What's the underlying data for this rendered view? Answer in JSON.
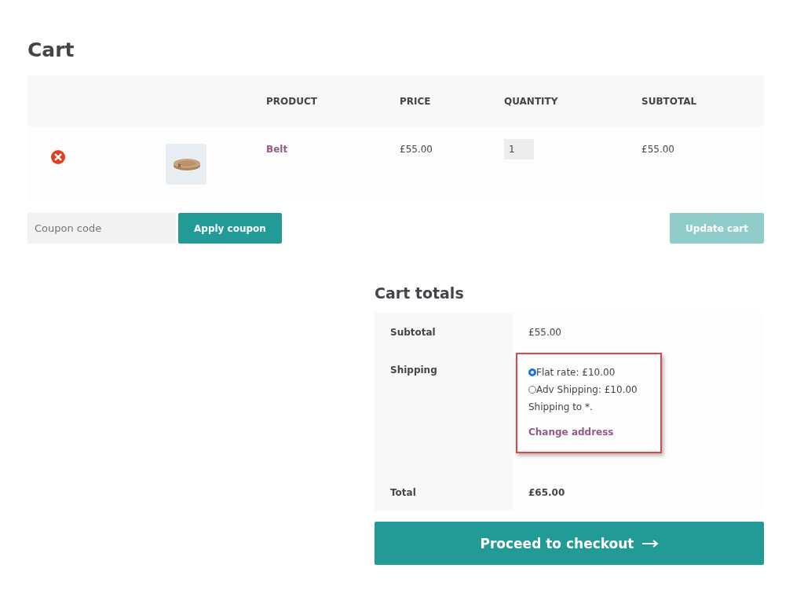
{
  "title": "Cart",
  "table": {
    "columns": [
      "PRODUCT",
      "PRICE",
      "QUANTITY",
      "SUBTOTAL"
    ],
    "rows": [
      {
        "product": "Belt",
        "price": "£55.00",
        "quantity": "1",
        "subtotal": "£55.00"
      }
    ]
  },
  "coupon": {
    "placeholder": "Coupon code",
    "apply_label": "Apply coupon"
  },
  "update_cart": {
    "label": "Update cart",
    "disabled": true
  },
  "cart_totals": {
    "title": "Cart totals",
    "subtotal": {
      "label": "Subtotal",
      "value": "£55.00"
    },
    "shipping": {
      "label": "Shipping",
      "options": [
        {
          "label": "Flat rate: £10.00",
          "selected": true
        },
        {
          "label": "Adv Shipping: £10.00",
          "selected": false
        }
      ],
      "destination": "Shipping to *.",
      "change_address": "Change address",
      "highlighted": true
    },
    "total": {
      "label": "Total",
      "value": "£65.00"
    }
  },
  "checkout_button": "Proceed to checkout"
}
